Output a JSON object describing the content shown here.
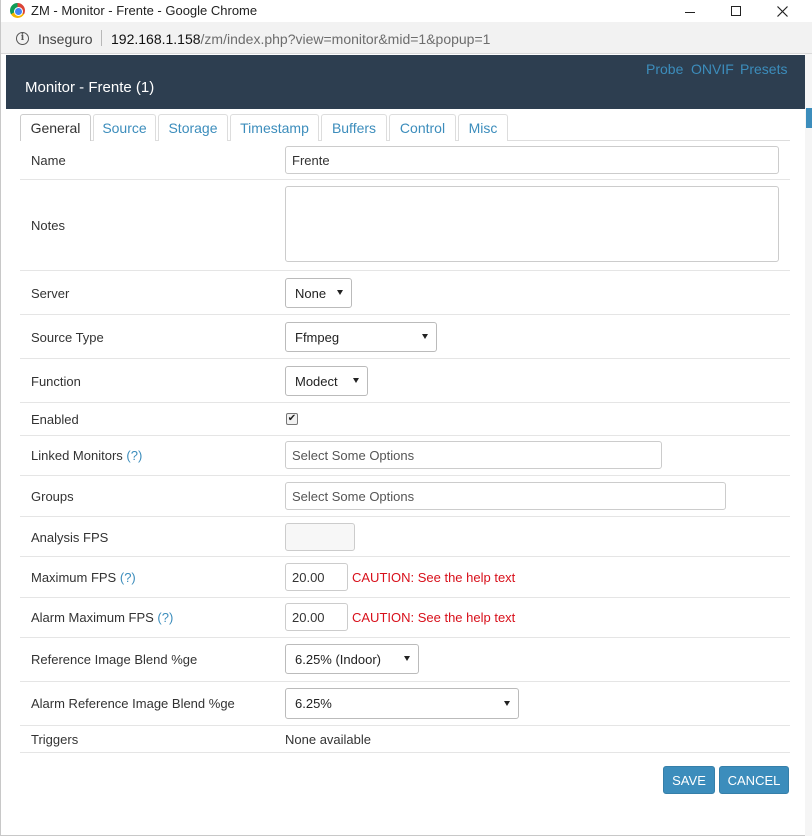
{
  "browser": {
    "title": "ZM - Monitor - Frente - Google Chrome",
    "security_label": "Inseguro",
    "url_host": "192.168.1.158",
    "url_path": "/zm/index.php?view=monitor&mid=1&popup=1"
  },
  "modal": {
    "title": "Monitor - Frente (1)",
    "links": [
      "Probe",
      "ONVIF",
      "Presets"
    ]
  },
  "tabs": [
    "General",
    "Source",
    "Storage",
    "Timestamp",
    "Buffers",
    "Control",
    "Misc"
  ],
  "active_tab": "General",
  "form": {
    "name": {
      "label": "Name",
      "value": "Frente"
    },
    "notes": {
      "label": "Notes",
      "value": ""
    },
    "server": {
      "label": "Server",
      "value": "None"
    },
    "source_type": {
      "label": "Source Type",
      "value": "Ffmpeg"
    },
    "function": {
      "label": "Function",
      "value": "Modect"
    },
    "enabled": {
      "label": "Enabled",
      "checked": true,
      "check_glyph": "✔"
    },
    "linked_monitors": {
      "label": "Linked Monitors",
      "help": "(?)",
      "placeholder": "Select Some Options"
    },
    "groups": {
      "label": "Groups",
      "placeholder": "Select Some Options"
    },
    "analysis_fps": {
      "label": "Analysis FPS",
      "value": ""
    },
    "max_fps": {
      "label": "Maximum FPS",
      "help": "(?)",
      "value": "20.00",
      "warning": "CAUTION: See the help text"
    },
    "alarm_max_fps": {
      "label": "Alarm Maximum FPS",
      "help": "(?)",
      "value": "20.00",
      "warning": "CAUTION: See the help text"
    },
    "ref_blend": {
      "label": "Reference Image Blend %ge",
      "value": "6.25% (Indoor)"
    },
    "alarm_ref_blend": {
      "label": "Alarm Reference Image Blend %ge",
      "value": "6.25%"
    },
    "triggers": {
      "label": "Triggers",
      "value": "None available"
    }
  },
  "buttons": {
    "save": "SAVE",
    "cancel": "CANCEL"
  },
  "colors": {
    "header_bg": "#2d3e50",
    "accent": "#3c8dbc",
    "warning": "#d8101b"
  }
}
